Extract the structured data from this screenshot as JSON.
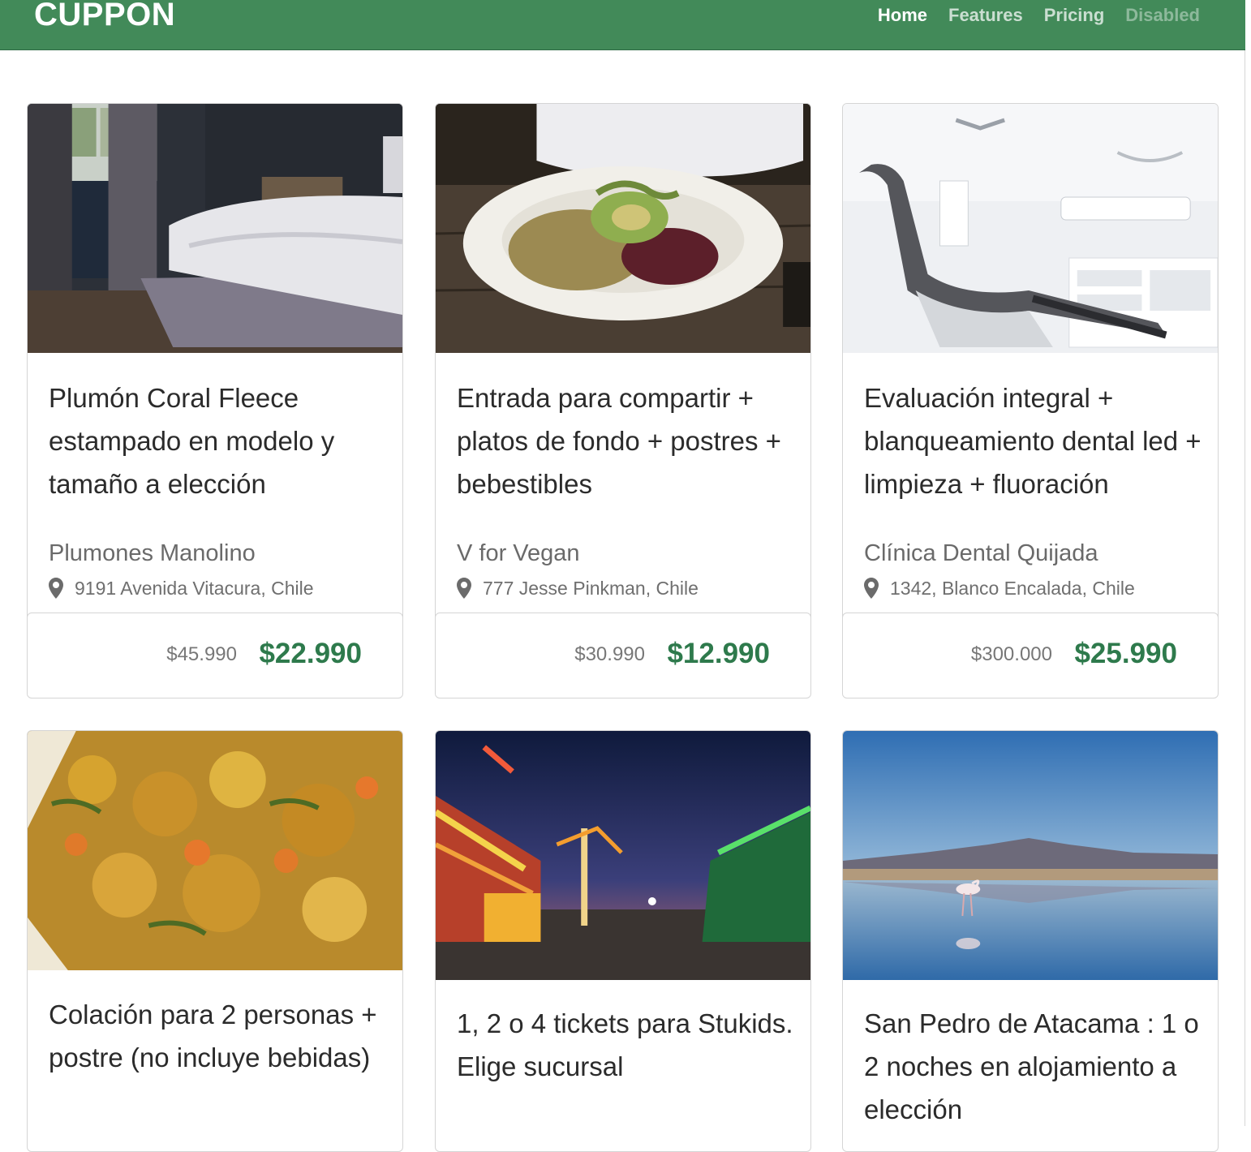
{
  "navbar": {
    "brand": "CUPPON",
    "links": [
      {
        "label": "Home",
        "state": "active"
      },
      {
        "label": "Features",
        "state": "normal"
      },
      {
        "label": "Pricing",
        "state": "normal"
      },
      {
        "label": "Disabled",
        "state": "disabled"
      }
    ]
  },
  "colors": {
    "navbar_bg": "#428a59",
    "price_green": "#2e7a4c"
  },
  "deals": [
    {
      "title": "Plumón Coral Fleece estampado en modelo y tamaño a elección",
      "merchant": "Plumones Manolino",
      "address": "9191 Avenida Vitacura, Chile",
      "old_price": "$45.990",
      "new_price": "$22.990",
      "image": "bedroom-photo"
    },
    {
      "title": "Entrada para compartir + platos de fondo + postres + bebestibles",
      "merchant": "V for Vegan",
      "address": "777 Jesse Pinkman, Chile",
      "old_price": "$30.990",
      "new_price": "$12.990",
      "image": "vegan-plate-photo"
    },
    {
      "title": "Evaluación integral + blanqueamiento dental led + limpieza + fluoración",
      "merchant": "Clínica Dental Quijada",
      "address": "1342, Blanco Encalada, Chile",
      "old_price": "$300.000",
      "new_price": "$25.990",
      "image": "dental-chair-photo"
    },
    {
      "title": "Colación para 2 personas + postre (no incluye bebidas)",
      "image": "food-dish-photo"
    },
    {
      "title": "1, 2 o 4 tickets para Stukids. Elige sucursal",
      "image": "fairground-night-photo"
    },
    {
      "title": "San Pedro de Atacama : 1 o 2 noches en alojamiento a elección",
      "image": "salt-lake-flamingo-photo"
    }
  ]
}
